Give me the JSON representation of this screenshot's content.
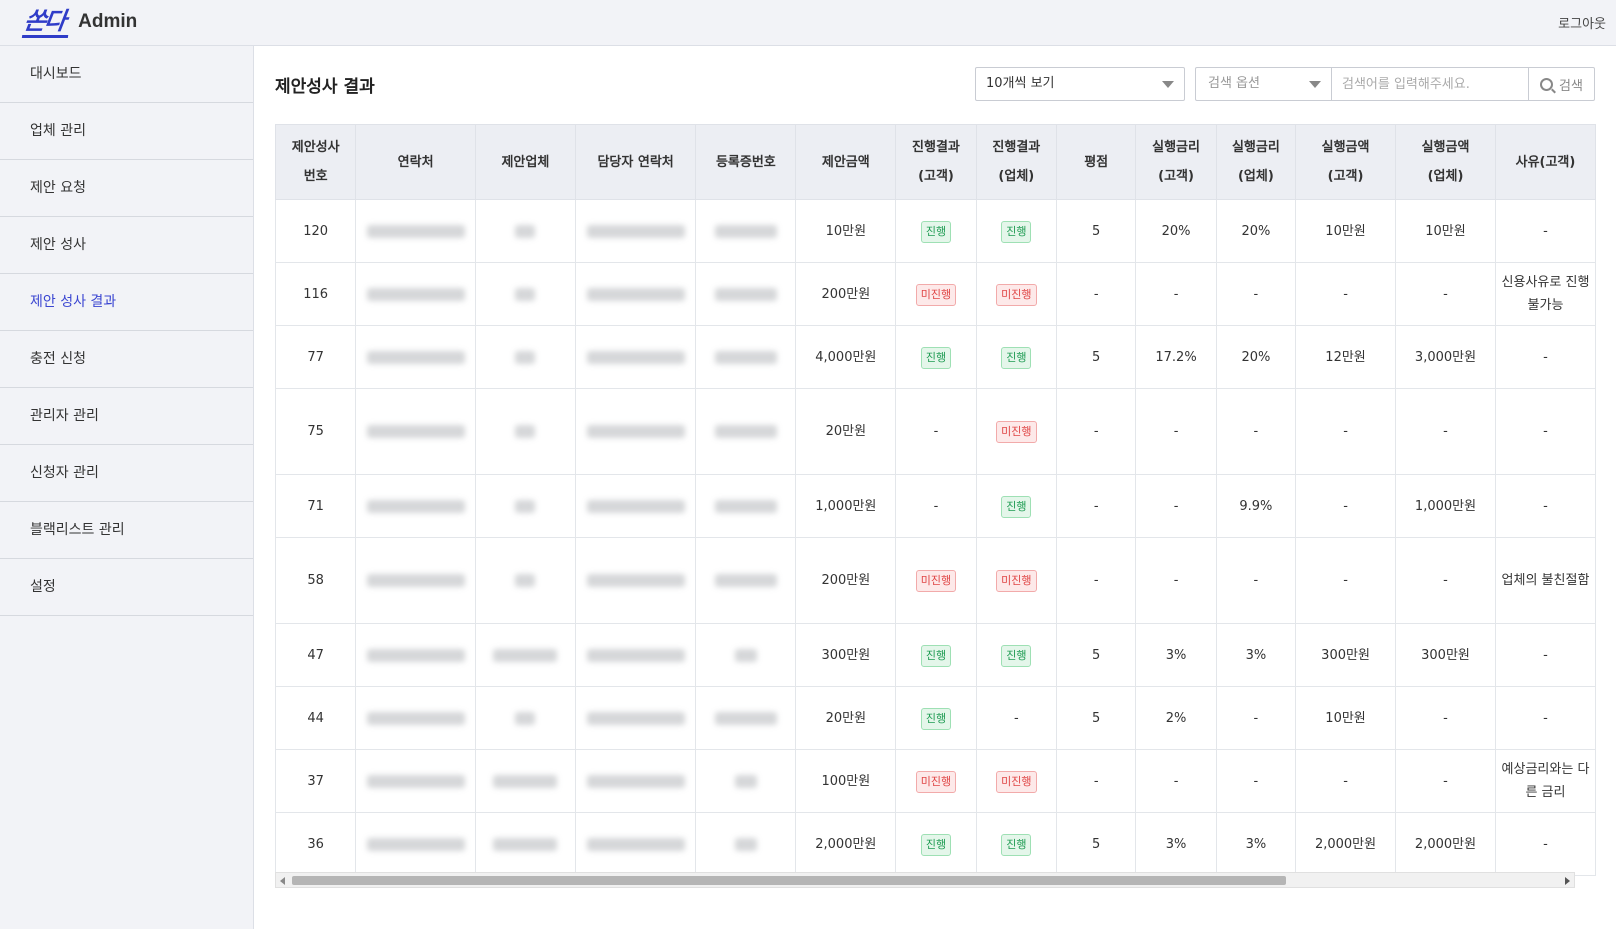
{
  "header": {
    "logo_mark": "쏜다",
    "app_name": "Admin",
    "logout": "로그아웃"
  },
  "sidebar": {
    "items": [
      {
        "label": "대시보드"
      },
      {
        "label": "업체 관리"
      },
      {
        "label": "제안 요청"
      },
      {
        "label": "제안 성사"
      },
      {
        "label": "제안 성사 결과",
        "active": true
      },
      {
        "label": "충전 신청"
      },
      {
        "label": "관리자 관리"
      },
      {
        "label": "신청자 관리"
      },
      {
        "label": "블랙리스트 관리"
      },
      {
        "label": "설정"
      }
    ]
  },
  "main": {
    "title": "제안성사 결과",
    "page_size": "10개씩 보기",
    "search_option_placeholder": "검색 옵션",
    "search_placeholder": "검색어를 입력해주세요.",
    "search_button": "검색"
  },
  "table": {
    "headers": [
      [
        "제안성사",
        "번호"
      ],
      [
        "연락처"
      ],
      [
        "제안업체"
      ],
      [
        "담당자 연락처"
      ],
      [
        "등록증번호"
      ],
      [
        "제안금액"
      ],
      [
        "진행결과",
        "(고객)"
      ],
      [
        "진행결과",
        "(업체)"
      ],
      [
        "평점"
      ],
      [
        "실행금리",
        "(고객)"
      ],
      [
        "실행금리",
        "(업체)"
      ],
      [
        "실행금액",
        "(고객)"
      ],
      [
        "실행금액",
        "(업체)"
      ],
      [
        "사유(고객)"
      ]
    ],
    "rows": [
      {
        "id": "120",
        "amount": "10만원",
        "res_c": "진행",
        "res_b": "진행",
        "rating": "5",
        "rate_c": "20%",
        "rate_b": "20%",
        "amt_c": "10만원",
        "amt_b": "10만원",
        "reason": "-"
      },
      {
        "id": "116",
        "amount": "200만원",
        "res_c": "미진행",
        "res_b": "미진행",
        "rating": "-",
        "rate_c": "-",
        "rate_b": "-",
        "amt_c": "-",
        "amt_b": "-",
        "reason": "신용사유로 진행 불가능"
      },
      {
        "id": "77",
        "amount": "4,000만원",
        "res_c": "진행",
        "res_b": "진행",
        "rating": "5",
        "rate_c": "17.2%",
        "rate_b": "20%",
        "amt_c": "12만원",
        "amt_b": "3,000만원",
        "reason": "-"
      },
      {
        "id": "75",
        "amount": "20만원",
        "res_c": "-",
        "res_b": "미진행",
        "rating": "-",
        "rate_c": "-",
        "rate_b": "-",
        "amt_c": "-",
        "amt_b": "-",
        "reason": "-"
      },
      {
        "id": "71",
        "amount": "1,000만원",
        "res_c": "-",
        "res_b": "진행",
        "rating": "-",
        "rate_c": "-",
        "rate_b": "9.9%",
        "amt_c": "-",
        "amt_b": "1,000만원",
        "reason": "-"
      },
      {
        "id": "58",
        "amount": "200만원",
        "res_c": "미진행",
        "res_b": "미진행",
        "rating": "-",
        "rate_c": "-",
        "rate_b": "-",
        "amt_c": "-",
        "amt_b": "-",
        "reason": "업체의 불친절함"
      },
      {
        "id": "47",
        "amount": "300만원",
        "res_c": "진행",
        "res_b": "진행",
        "rating": "5",
        "rate_c": "3%",
        "rate_b": "3%",
        "amt_c": "300만원",
        "amt_b": "300만원",
        "reason": "-"
      },
      {
        "id": "44",
        "amount": "20만원",
        "res_c": "진행",
        "res_b": "-",
        "rating": "5",
        "rate_c": "2%",
        "rate_b": "-",
        "amt_c": "10만원",
        "amt_b": "-",
        "reason": "-"
      },
      {
        "id": "37",
        "amount": "100만원",
        "res_c": "미진행",
        "res_b": "미진행",
        "rating": "-",
        "rate_c": "-",
        "rate_b": "-",
        "amt_c": "-",
        "amt_b": "-",
        "reason": "예상금리와는 다른 금리"
      },
      {
        "id": "36",
        "amount": "2,000만원",
        "res_c": "진행",
        "res_b": "진행",
        "rating": "5",
        "rate_c": "3%",
        "rate_b": "3%",
        "amt_c": "2,000만원",
        "amt_b": "2,000만원",
        "reason": "-"
      }
    ]
  },
  "colors": {
    "accent": "#3b46d1",
    "ok": "#1e9b52",
    "no": "#e04545"
  }
}
